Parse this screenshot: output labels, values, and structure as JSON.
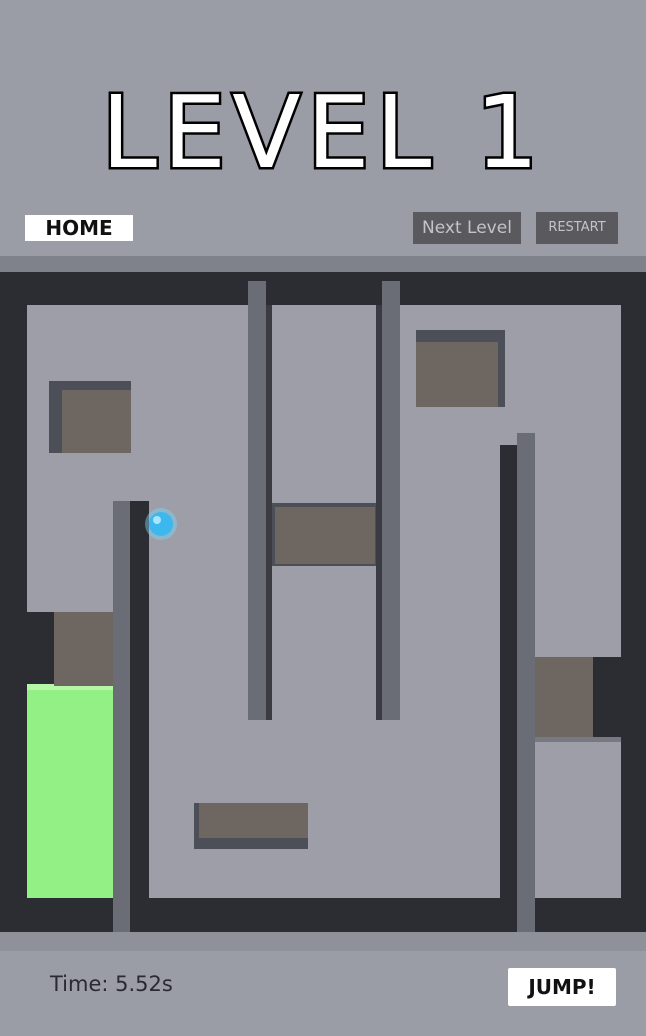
{
  "header": {
    "title": "LEVEL 1",
    "home_label": "HOME",
    "next_level_label": "Next Level",
    "restart_label": "RESTART"
  },
  "footer": {
    "timer_text": "Time: 5.52s",
    "jump_label": "JUMP!"
  },
  "colors": {
    "background": "#9a9ca6",
    "maze_floor": "#9d9ea8",
    "maze_wall": "#2c2d33",
    "block": "#6e6660",
    "goal": "#93f084",
    "ball": "#3db8ee"
  }
}
